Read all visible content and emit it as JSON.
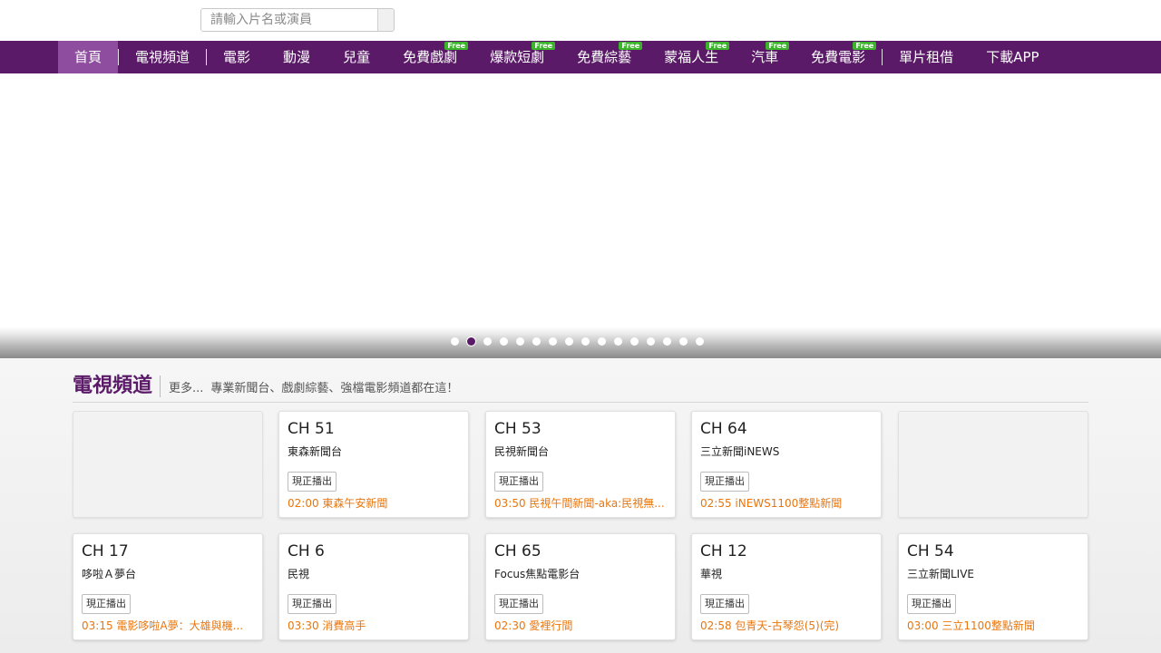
{
  "search": {
    "placeholder": "請輸入片名或演員"
  },
  "nav": {
    "items": [
      {
        "label": "首頁",
        "free": false,
        "active": true
      },
      {
        "label": "電視頻道",
        "free": false
      },
      {
        "label": "電影",
        "free": false
      },
      {
        "label": "動漫",
        "free": false
      },
      {
        "label": "兒童",
        "free": false
      },
      {
        "label": "免費戲劇",
        "free": true
      },
      {
        "label": "爆款短劇",
        "free": true
      },
      {
        "label": "免費綜藝",
        "free": true
      },
      {
        "label": "蒙福人生",
        "free": true
      },
      {
        "label": "汽車",
        "free": true
      },
      {
        "label": "免費電影",
        "free": true
      },
      {
        "label": "單片租借",
        "free": false
      },
      {
        "label": "下載APP",
        "free": false
      }
    ],
    "free_badge": "Free"
  },
  "carousel": {
    "dot_count": 16,
    "active_index": 1
  },
  "section": {
    "title": "電視頻道",
    "more": "更多...",
    "desc": "專業新聞台、戲劇綜藝、強檔電影頻道都在這！"
  },
  "channels": {
    "now_label": "現正播出",
    "row1": [
      {
        "empty": true
      },
      {
        "ch": "CH 51",
        "name": "東森新聞台",
        "program": "02:00 東森午安新聞"
      },
      {
        "ch": "CH 53",
        "name": "民視新聞台",
        "program": "03:50 民視午間新聞-aka:民視無..."
      },
      {
        "ch": "CH 64",
        "name": "三立新聞iNEWS",
        "program": "02:55 iNEWS1100整點新聞"
      },
      {
        "empty": true
      }
    ],
    "row2": [
      {
        "ch": "CH 17",
        "name": "哆啦Ａ夢台",
        "program": "03:15 電影哆啦A夢：大雄與機..."
      },
      {
        "ch": "CH 6",
        "name": "民視",
        "program": "03:30 消費高手"
      },
      {
        "ch": "CH 65",
        "name": "Focus焦點電影台",
        "program": "02:30 愛裡行間"
      },
      {
        "ch": "CH 12",
        "name": "華視",
        "program": "02:58 包青天-古琴怨(5)(完)"
      },
      {
        "ch": "CH 54",
        "name": "三立新聞LIVE",
        "program": "03:00 三立1100整點新聞"
      }
    ]
  },
  "colors": {
    "brand": "#5a1a67",
    "active_tab": "#8f4da0",
    "program_text": "#e8760f",
    "free_badge": "#3bb42c"
  }
}
